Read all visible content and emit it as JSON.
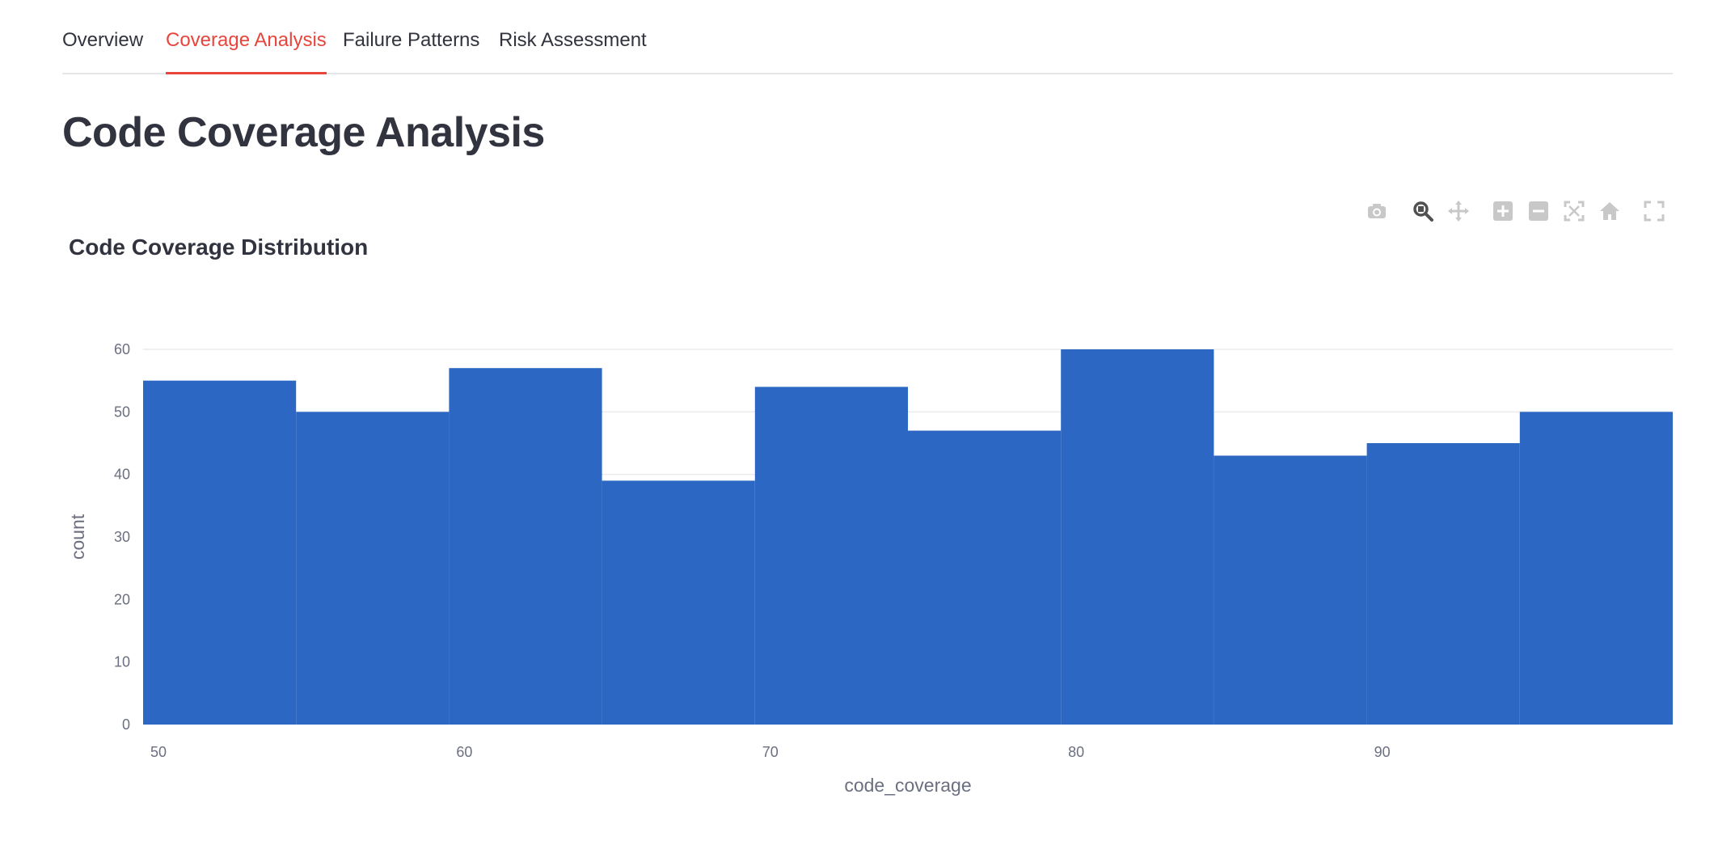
{
  "tabs": [
    {
      "label": "Overview",
      "active": false
    },
    {
      "label": "Coverage Analysis",
      "active": true
    },
    {
      "label": "Failure Patterns",
      "active": false
    },
    {
      "label": "Risk Assessment",
      "active": false
    }
  ],
  "page": {
    "title": "Code Coverage Analysis"
  },
  "modebar": {
    "icons": [
      "camera-icon",
      "zoom-icon",
      "pan-icon",
      "zoom-in-icon",
      "zoom-out-icon",
      "autoscale-icon",
      "reset-axes-icon",
      "fullscreen-icon"
    ],
    "active": "zoom-icon"
  },
  "colors": {
    "accent": "#e8453c",
    "bar": "#2c67c4",
    "grid": "#e6e6e9",
    "tick": "#6b6f80"
  },
  "chart_data": {
    "type": "bar",
    "title": "Code Coverage Distribution",
    "xlabel": "code_coverage",
    "ylabel": "count",
    "bins": [
      {
        "x0": 50,
        "x1": 55,
        "count": 55
      },
      {
        "x0": 55,
        "x1": 60,
        "count": 50
      },
      {
        "x0": 60,
        "x1": 65,
        "count": 57
      },
      {
        "x0": 65,
        "x1": 70,
        "count": 39
      },
      {
        "x0": 70,
        "x1": 75,
        "count": 54
      },
      {
        "x0": 75,
        "x1": 80,
        "count": 47
      },
      {
        "x0": 80,
        "x1": 85,
        "count": 60
      },
      {
        "x0": 85,
        "x1": 90,
        "count": 43
      },
      {
        "x0": 90,
        "x1": 95,
        "count": 45
      },
      {
        "x0": 95,
        "x1": 100,
        "count": 50
      }
    ],
    "xlim": [
      50,
      100
    ],
    "ylim": [
      0,
      60
    ],
    "xticks": [
      50,
      60,
      70,
      80,
      90
    ],
    "yticks": [
      0,
      10,
      20,
      30,
      40,
      50,
      60
    ],
    "grid": true,
    "legend": false
  }
}
